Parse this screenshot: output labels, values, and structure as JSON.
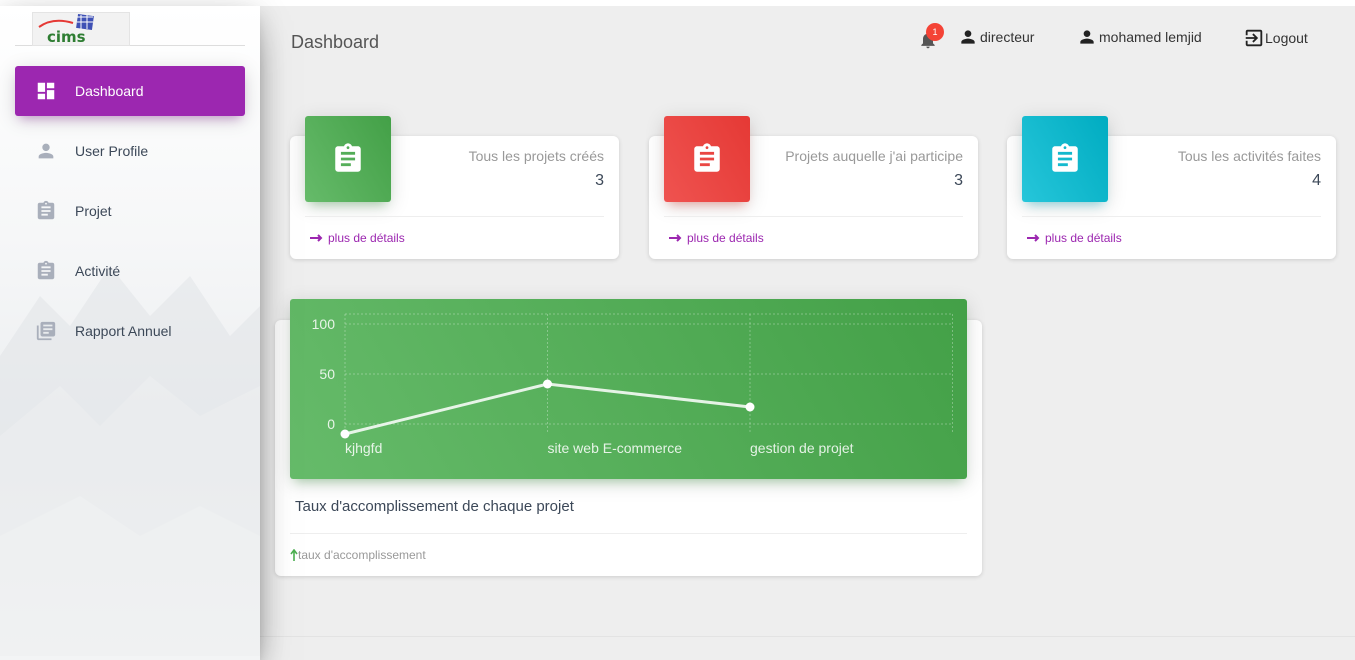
{
  "header": {
    "title": "Dashboard",
    "notification_count": "1",
    "role": "directeur",
    "user_name": "mohamed lemjid",
    "logout_label": "Logout"
  },
  "sidebar": {
    "logo_text": "cims",
    "items": [
      {
        "label": "Dashboard",
        "icon": "dashboard-icon",
        "active": true
      },
      {
        "label": "User Profile",
        "icon": "person-icon"
      },
      {
        "label": "Projet",
        "icon": "content-paste-icon"
      },
      {
        "label": "Activité",
        "icon": "content-paste-icon"
      },
      {
        "label": "Rapport Annuel",
        "icon": "library-books-icon"
      }
    ]
  },
  "stats": [
    {
      "category": "Tous les projets créés",
      "value": "3",
      "footer": "plus de détails",
      "color": "#4caf50",
      "icon": "content-paste-icon"
    },
    {
      "category": "Projets auquelle j'ai participe",
      "value": "3",
      "footer": "plus de détails",
      "color": "#f44336",
      "icon": "content-paste-icon"
    },
    {
      "category": "Tous les activités faites",
      "value": "4",
      "footer": "plus de détails",
      "color": "#00bcd4",
      "icon": "content-paste-icon"
    }
  ],
  "chart_card": {
    "title": "Taux d'accomplissement de chaque projet",
    "footer": "taux d'accomplissement"
  },
  "chart_data": {
    "type": "line",
    "categories": [
      "kjhgfd",
      "site web E-commerce",
      "gestion de projet"
    ],
    "values": [
      -10,
      40,
      17
    ],
    "ylim": [
      -10,
      110
    ],
    "yticks": [
      0,
      50,
      100
    ],
    "grid": true,
    "title": "",
    "xlabel": "",
    "ylabel": ""
  },
  "colors": {
    "accent": "#9c27b0",
    "green": "#4caf50",
    "red": "#f44336",
    "cyan": "#00bcd4",
    "badge": "#f44336"
  }
}
